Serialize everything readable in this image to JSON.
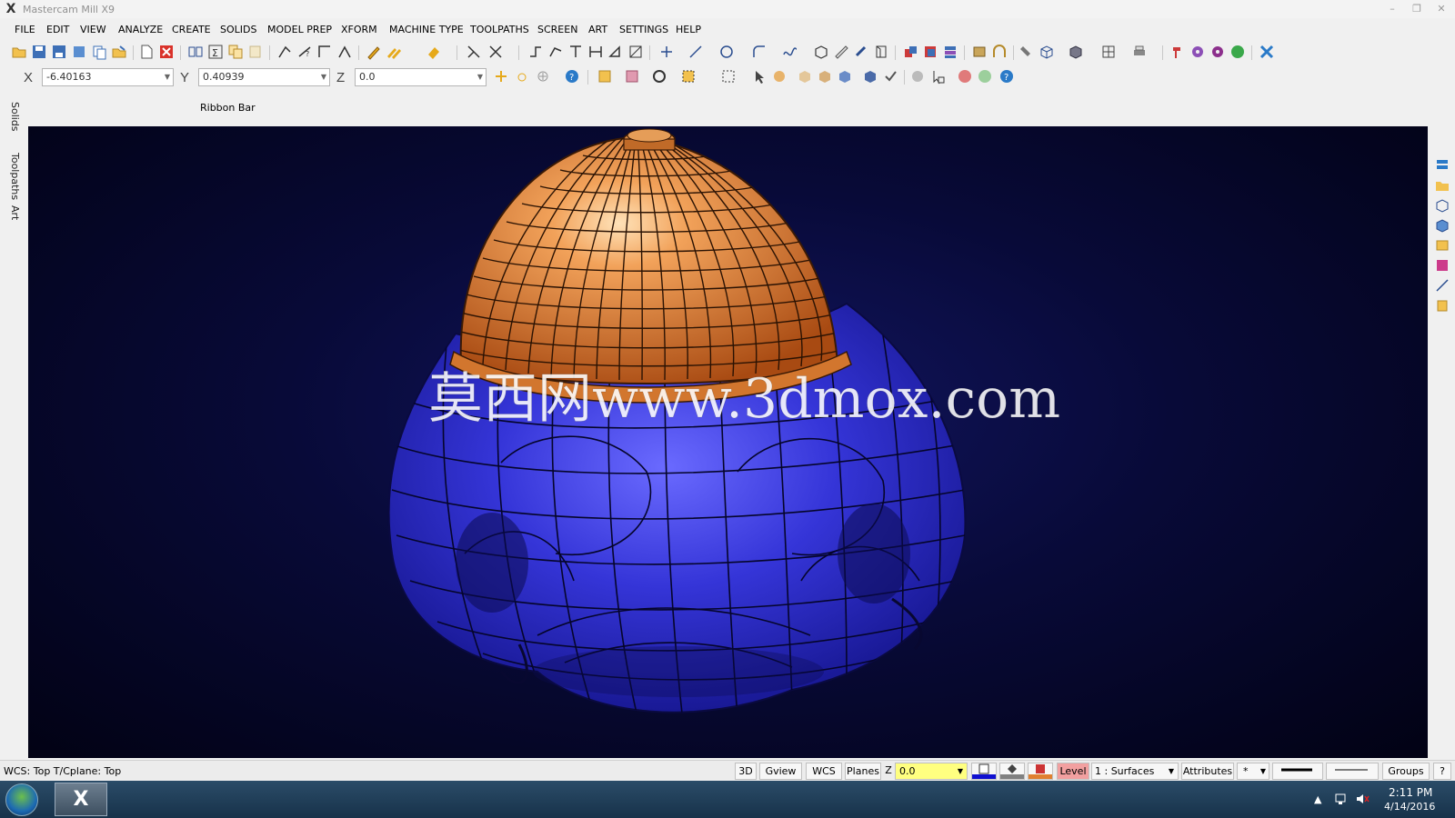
{
  "window": {
    "title": "Mastercam Mill X9",
    "minimize_glyph": "–",
    "restore_glyph": "❐",
    "close_glyph": "✕"
  },
  "menu": [
    "FILE",
    "EDIT",
    "VIEW",
    "ANALYZE",
    "CREATE",
    "SOLIDS",
    "MODEL PREP",
    "XFORM",
    "MACHINE TYPE",
    "TOOLPATHS",
    "SCREEN",
    "ART",
    "SETTINGS",
    "HELP"
  ],
  "coords": {
    "x_label": "X",
    "x_value": "-6.40163",
    "y_label": "Y",
    "y_value": "0.40939",
    "z_label": "Z",
    "z_value": "0.0"
  },
  "ribbon_label": "Ribbon Bar",
  "side_tabs": [
    "Solids",
    "Toolpaths",
    "Art"
  ],
  "viewport": {
    "watermark": "莫西网www.3dmox.com",
    "model": "dome-cap-on-wireframe-mesh",
    "dome_color": "#d2762e",
    "body_color": "#3535d8"
  },
  "statusbar": {
    "wcs_text": "WCS: Top  T/Cplane: Top",
    "btn_3d": "3D",
    "btn_gview": "Gview",
    "btn_wcs": "WCS",
    "btn_planes": "Planes",
    "z_label": "Z",
    "z_value": "0.0",
    "level_label": "Level",
    "level_value": "1 : Surfaces",
    "attributes": "Attributes",
    "point_style": "*",
    "groups": "Groups",
    "help": "?"
  },
  "taskbar": {
    "app_icon": "mastercam-icon",
    "time": "2:11 PM",
    "date": "4/14/2016"
  }
}
